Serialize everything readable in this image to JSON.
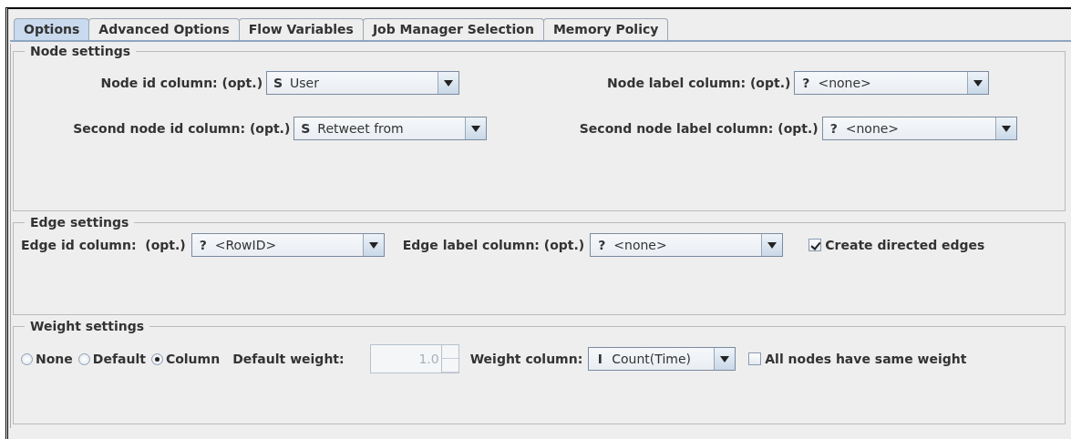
{
  "tabs": [
    {
      "label": "Options",
      "selected": true
    },
    {
      "label": "Advanced Options",
      "selected": false
    },
    {
      "label": "Flow Variables",
      "selected": false
    },
    {
      "label": "Job Manager Selection",
      "selected": false
    },
    {
      "label": "Memory Policy",
      "selected": false
    }
  ],
  "node_settings": {
    "title": "Node settings",
    "fields": [
      {
        "label": "Node id column: (opt.)",
        "type_icon": "S",
        "value": "User"
      },
      {
        "label": "Node label column: (opt.)",
        "type_icon": "?",
        "value": "<none>"
      },
      {
        "label": "Second node id column: (opt.)",
        "type_icon": "S",
        "value": "Retweet from"
      },
      {
        "label": "Second node label column: (opt.)",
        "type_icon": "?",
        "value": "<none>"
      }
    ]
  },
  "edge_settings": {
    "title": "Edge settings",
    "fields": [
      {
        "label": "Edge id column:  (opt.)",
        "type_icon": "?",
        "value": "<RowID>"
      },
      {
        "label": "Edge label column: (opt.)",
        "type_icon": "?",
        "value": "<none>"
      }
    ],
    "checkbox": {
      "label": "Create directed edges",
      "checked": true
    }
  },
  "weight_settings": {
    "title": "Weight settings",
    "radios": [
      {
        "label": "None",
        "selected": false
      },
      {
        "label": "Default",
        "selected": false
      },
      {
        "label": "Column",
        "selected": true
      }
    ],
    "default_weight": {
      "label": "Default weight:",
      "value": "1.0",
      "disabled": true
    },
    "weight_column": {
      "label": "Weight column:",
      "type_icon": "I",
      "value": "Count(Time)"
    },
    "checkbox": {
      "label": "All nodes have same weight",
      "checked": false
    }
  }
}
